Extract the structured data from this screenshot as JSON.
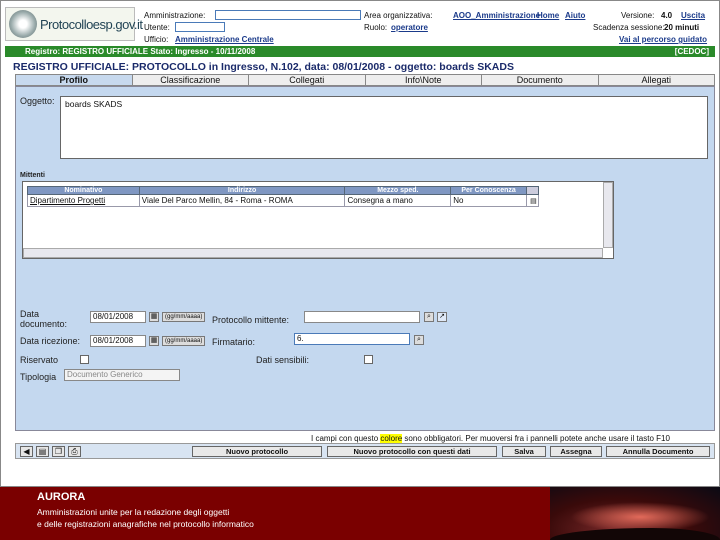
{
  "header": {
    "logo_text": "Protocolloesp.gov.it",
    "amministrazione_label": "Amministrazione:",
    "area_label": "Area organizzativa:",
    "area_value": "AOO_Amministrazione",
    "home_link": "Home",
    "aiuto_link": "Aiuto",
    "versione_label": "Versione:",
    "versione_value": "4.0",
    "uscita_link": "Uscita",
    "utente_label": "Utente:",
    "ruolo_label": "Ruolo:",
    "ruolo_value": "operatore",
    "scadenza_label": "Scadenza sessione:",
    "scadenza_value": "20 minuti",
    "ufficio_label": "Ufficio:",
    "ufficio_value": "Amministrazione Centrale",
    "percorso_link": "Vai al percorso guidato"
  },
  "statusbar": {
    "text": "Registro: REGISTRO UFFICIALE   Stato: Ingresso - 10/11/2008",
    "right": "[CEDOC]"
  },
  "record_title": "REGISTRO UFFICIALE: PROTOCOLLO in Ingresso, N.102, data: 08/01/2008 - oggetto: boards SKADS",
  "tabs": [
    "Profilo",
    "Classificazione",
    "Collegati",
    "Info\\Note",
    "Documento",
    "Allegati"
  ],
  "form": {
    "oggetto_label": "Oggetto:",
    "oggetto_value": "boards SKADS",
    "mittenti_label": "Mittenti",
    "mittenti_columns": [
      "Nominativo",
      "Indirizzo",
      "Mezzo sped.",
      "Per Conoscenza"
    ],
    "mittenti_rows": [
      [
        "Dipartimento Progetti",
        "Viale Del Parco Mellin, 84 - Roma - ROMA",
        "Consegna a mano",
        "No"
      ]
    ],
    "data_documento_label": "Data documento:",
    "data_documento_value": "08/01/2008",
    "data_ricezione_label": "Data ricezione:",
    "data_ricezione_value": "08/01/2008",
    "date_format": "(gg/mm/aaaa)",
    "protocollo_mittente_label": "Protocollo mittente:",
    "firmatario_label": "Firmatario:",
    "firmatario_value": "6.",
    "riservato_label": "Riservato",
    "dati_sensibili_label": "Dati sensibili:",
    "tipologia_label": "Tipologia",
    "tipologia_value": "Documento Generico"
  },
  "note": {
    "prefix": "I campi con questo",
    "highlight": "colore",
    "suffix": "sono obbligatori. Per muoversi fra i pannelli potete anche usare il tasto F10"
  },
  "actions": [
    "Nuovo protocollo",
    "Nuovo protocollo con questi dati",
    "Salva",
    "Assegna",
    "Annulla Documento"
  ],
  "footer": {
    "title": "AURORA",
    "line1": "Amministrazioni unite per la redazione degli oggetti",
    "line2": "e delle registrazioni anagrafiche nel protocollo informatico"
  },
  "colors": {
    "statusbar": "#2a8a2a",
    "panel": "#c4d8ef",
    "footer": "#7a0000"
  }
}
